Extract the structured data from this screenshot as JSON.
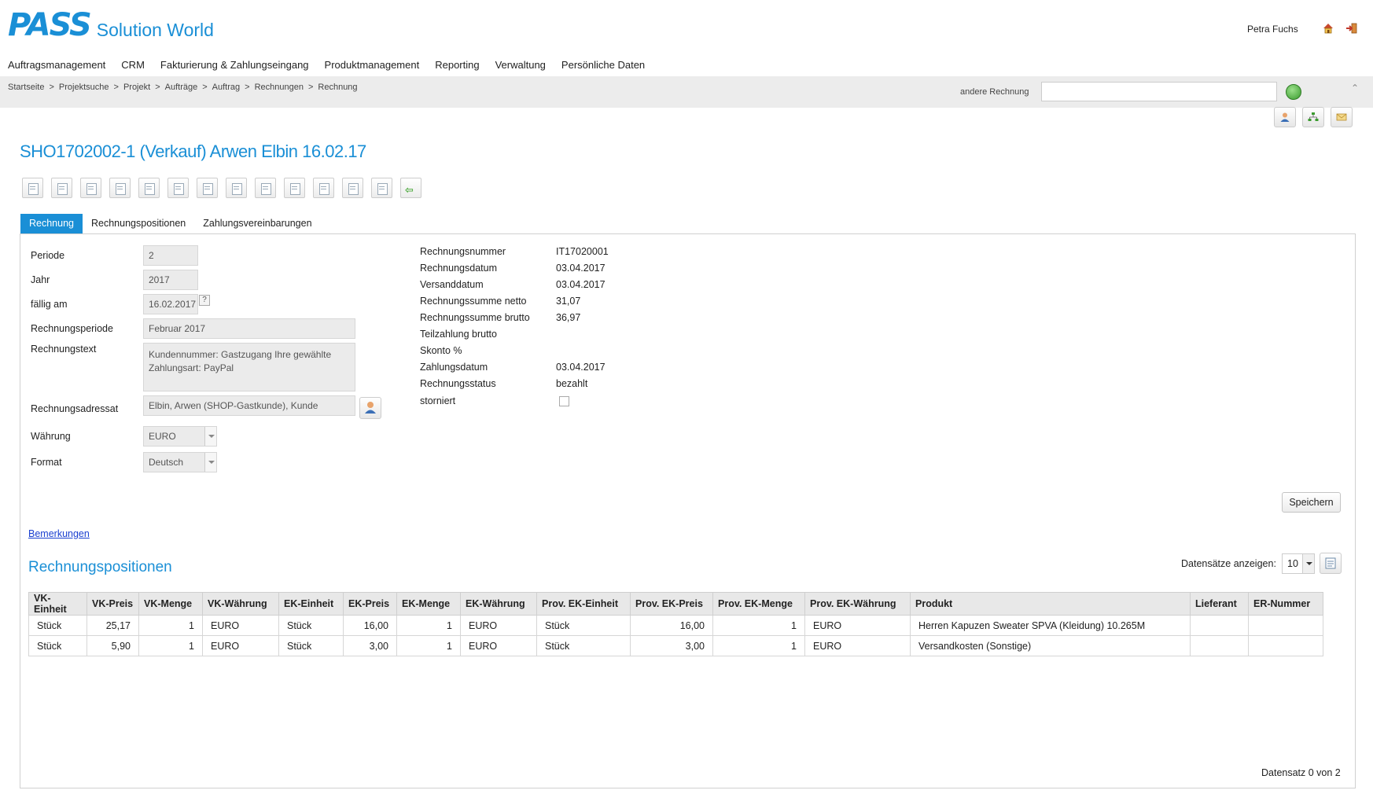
{
  "header": {
    "logo_text": "PASS",
    "app_name": "Solution World",
    "user_name": "Petra Fuchs",
    "home_icon": "home-icon",
    "logout_icon": "logout-icon"
  },
  "menu": [
    "Auftragsmanagement",
    "CRM",
    "Fakturierung & Zahlungseingang",
    "Produktmanagement",
    "Reporting",
    "Verwaltung",
    "Persönliche Daten"
  ],
  "breadcrumb": [
    "Startseite",
    "Projektsuche",
    "Projekt",
    "Aufträge",
    "Auftrag",
    "Rechnungen",
    "Rechnung"
  ],
  "breadcrumb_sep": ">",
  "search": {
    "label": "andere Rechnung",
    "value": ""
  },
  "page_title": "SHO1702002-1 (Verkauf) Arwen Elbin 16.02.17",
  "tabs": [
    "Rechnung",
    "Rechnungspositionen",
    "Zahlungsvereinbarungen"
  ],
  "form": {
    "periode_label": "Periode",
    "periode_value": "2",
    "jahr_label": "Jahr",
    "jahr_value": "2017",
    "faellig_label": "fällig am",
    "faellig_value": "16.02.2017",
    "rperiode_label": "Rechnungsperiode",
    "rperiode_value": "Februar 2017",
    "rtext_label": "Rechnungstext",
    "rtext_value": "Kundennummer: Gastzugang  Ihre gewählte Zahlungsart: PayPal",
    "radressat_label": "Rechnungsadressat",
    "radressat_value": "Elbin, Arwen (SHOP-Gastkunde), Kunde",
    "waehrung_label": "Währung",
    "waehrung_value": "EURO",
    "format_label": "Format",
    "format_value": "Deutsch",
    "help_glyph": "?"
  },
  "summary": [
    {
      "label": "Rechnungsnummer",
      "value": "IT17020001"
    },
    {
      "label": "Rechnungsdatum",
      "value": "03.04.2017"
    },
    {
      "label": "Versanddatum",
      "value": "03.04.2017"
    },
    {
      "label": "Rechnungssumme netto",
      "value": "31,07"
    },
    {
      "label": "Rechnungssumme brutto",
      "value": "36,97"
    },
    {
      "label": "Teilzahlung brutto",
      "value": ""
    },
    {
      "label": "Skonto %",
      "value": ""
    },
    {
      "label": "Zahlungsdatum",
      "value": "03.04.2017"
    },
    {
      "label": "Rechnungsstatus",
      "value": "bezahlt"
    },
    {
      "label": "storniert",
      "value": ""
    }
  ],
  "save_label": "Speichern",
  "remarks_label": "Bemerkungen",
  "positions": {
    "title": "Rechnungspositionen",
    "page_size_label": "Datensätze anzeigen:",
    "page_size": "10",
    "columns": [
      "VK-Einheit",
      "VK-Preis",
      "VK-Menge",
      "VK-Währung",
      "EK-Einheit",
      "EK-Preis",
      "EK-Menge",
      "EK-Währung",
      "Prov. EK-Einheit",
      "Prov. EK-Preis",
      "Prov. EK-Menge",
      "Prov. EK-Währung",
      "Produkt",
      "Lieferant",
      "ER-Nummer"
    ],
    "rows": [
      [
        "Stück",
        "25,17",
        "1",
        "EURO",
        "Stück",
        "16,00",
        "1",
        "EURO",
        "Stück",
        "16,00",
        "1",
        "EURO",
        "Herren Kapuzen Sweater SPVA (Kleidung) 10.265M",
        "",
        ""
      ],
      [
        "Stück",
        "5,90",
        "1",
        "EURO",
        "Stück",
        "3,00",
        "1",
        "EURO",
        "Stück",
        "3,00",
        "1",
        "EURO",
        "Versandkosten (Sonstige)",
        "",
        ""
      ]
    ],
    "footer": "Datensatz  0 von  2"
  }
}
